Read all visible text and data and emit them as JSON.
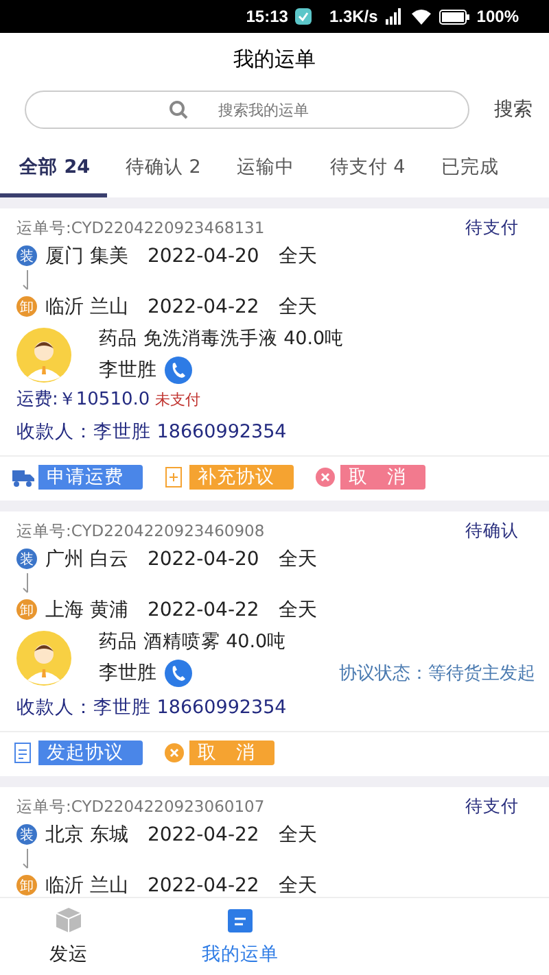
{
  "status_bar": {
    "time": "15:13",
    "speed": "1.3K/s",
    "battery": "100%"
  },
  "header": {
    "title": "我的运单"
  },
  "search": {
    "placeholder": "搜索我的运单",
    "button": "搜索"
  },
  "tabs": [
    {
      "label": "全部 24",
      "selected": true
    },
    {
      "label": "待确认 2",
      "selected": false
    },
    {
      "label": "运输中",
      "selected": false
    },
    {
      "label": "待支付 4",
      "selected": false
    },
    {
      "label": "已完成",
      "selected": false
    }
  ],
  "orders": [
    {
      "number": "运单号:CYD2204220923468131",
      "status": "待支付",
      "load": {
        "badge": "装",
        "place": "厦门 集美",
        "date": "2022-04-20",
        "time": "全天"
      },
      "unload": {
        "badge": "卸",
        "place": "临沂 兰山",
        "date": "2022-04-22",
        "time": "全天"
      },
      "goods": "药品  免洗消毒洗手液 40.0吨",
      "contact": "李世胜",
      "freight": "运费:￥10510.0",
      "payment_status": "未支付",
      "payee": "收款人：李世胜   18660992354",
      "actions": [
        {
          "kind": "fee",
          "label": "申请运费",
          "color": "#4a86e8"
        },
        {
          "kind": "supplement",
          "label": "补充协议",
          "color": "#f5a331"
        },
        {
          "kind": "cancel",
          "label": "取　消",
          "color": "#f27a8e"
        }
      ]
    },
    {
      "number": "运单号:CYD2204220923460908",
      "status": "待确认",
      "load": {
        "badge": "装",
        "place": "广州 白云",
        "date": "2022-04-20",
        "time": "全天"
      },
      "unload": {
        "badge": "卸",
        "place": "上海 黄浦",
        "date": "2022-04-22",
        "time": "全天"
      },
      "goods": "药品  酒精喷雾 40.0吨",
      "contact": "李世胜",
      "agreement_status": "协议状态：等待货主发起",
      "payee": "收款人：李世胜   18660992354",
      "actions": [
        {
          "kind": "initiate",
          "label": "发起协议",
          "color": "#4a86e8"
        },
        {
          "kind": "cancel",
          "label": "取　消",
          "color": "#f5a331"
        }
      ]
    },
    {
      "number": "运单号:CYD2204220923060107",
      "status": "待支付",
      "load": {
        "badge": "装",
        "place": "北京 东城",
        "date": "2022-04-22",
        "time": "全天"
      },
      "unload": {
        "badge": "卸",
        "place": "临沂 兰山",
        "date": "2022-04-22",
        "time": "全天"
      }
    }
  ],
  "bottom_nav": [
    {
      "label": "发运",
      "selected": false
    },
    {
      "label": "我的运单",
      "selected": true
    }
  ]
}
